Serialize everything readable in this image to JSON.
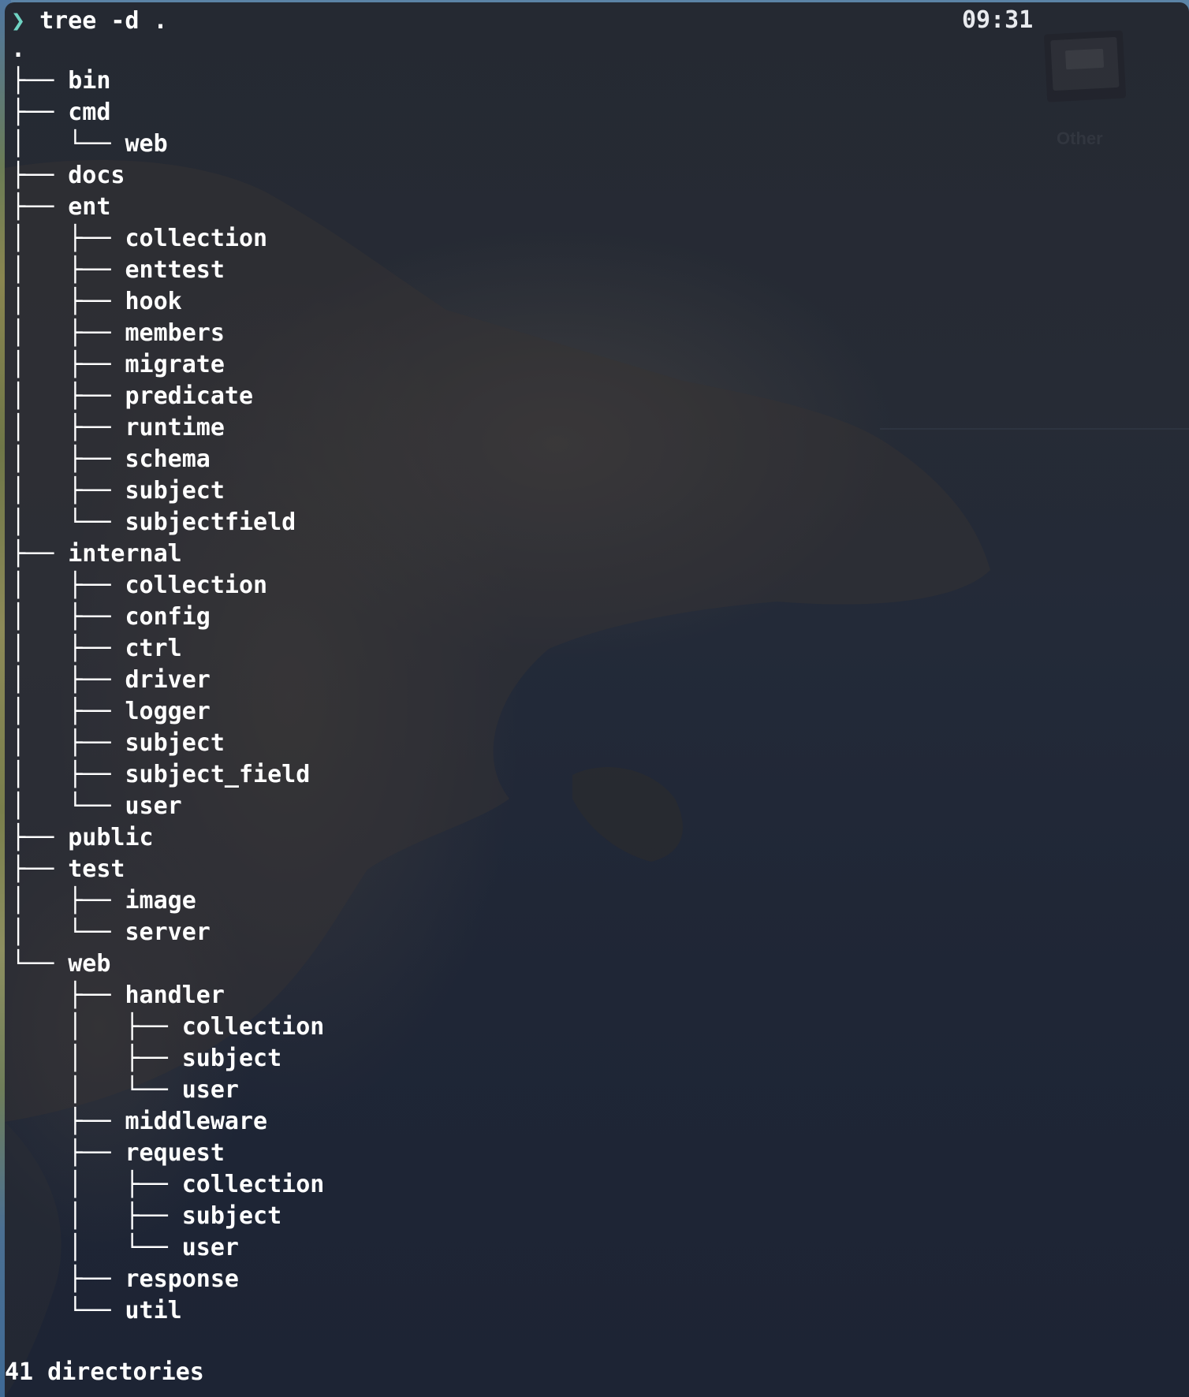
{
  "terminal": {
    "prompt_symbol": "❯",
    "command": "tree -d .",
    "clock": "09:31",
    "widget_label": "Other",
    "output_lines": [
      ".",
      "├── bin",
      "├── cmd",
      "│   └── web",
      "├── docs",
      "├── ent",
      "│   ├── collection",
      "│   ├── enttest",
      "│   ├── hook",
      "│   ├── members",
      "│   ├── migrate",
      "│   ├── predicate",
      "│   ├── runtime",
      "│   ├── schema",
      "│   ├── subject",
      "│   └── subjectfield",
      "├── internal",
      "│   ├── collection",
      "│   ├── config",
      "│   ├── ctrl",
      "│   ├── driver",
      "│   ├── logger",
      "│   ├── subject",
      "│   ├── subject_field",
      "│   └── user",
      "├── public",
      "├── test",
      "│   ├── image",
      "│   └── server",
      "└── web",
      "    ├── handler",
      "    │   ├── collection",
      "    │   ├── subject",
      "    │   └── user",
      "    ├── middleware",
      "    ├── request",
      "    │   ├── collection",
      "    │   ├── subject",
      "    │   └── user",
      "    ├── response",
      "    └── util"
    ],
    "summary": "41 directories"
  },
  "colors": {
    "prompt_accent": "#6fd3c3",
    "text": "#ffffff",
    "background": "#232a36"
  }
}
